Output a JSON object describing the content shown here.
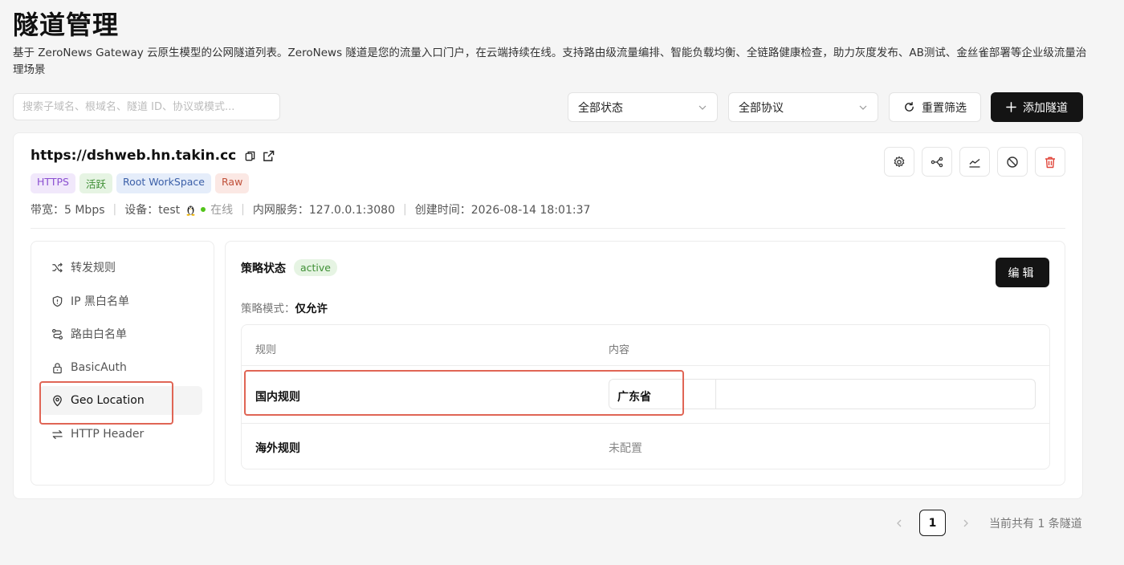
{
  "page": {
    "title": "隧道管理",
    "description": "基于 ZeroNews Gateway 云原生模型的公网隧道列表。ZeroNews 隧道是您的流量入口门户，在云端持续在线。支持路由级流量编排、智能负载均衡、全链路健康检查，助力灰度发布、AB测试、金丝雀部署等企业级流量治理场景"
  },
  "filters": {
    "search_placeholder": "搜索子域名、根域名、隧道 ID、协议或模式...",
    "search_value": "",
    "status_value": "全部状态",
    "protocol_value": "全部协议",
    "reset_label": "重置筛选",
    "add_label": "添加隧道"
  },
  "tunnel": {
    "url": "https://dshweb.hn.takin.cc",
    "tags": {
      "protocol": "HTTPS",
      "status": "活跃",
      "workspace": "Root WorkSpace",
      "mode": "Raw"
    },
    "meta": {
      "bandwidth": "带宽：5 Mbps",
      "device_prefix": "设备：test",
      "device_status": "在线",
      "service": "内网服务：127.0.0.1:3080",
      "created": "创建时间：2026-08-14 18:01:37"
    }
  },
  "side_nav": {
    "items": [
      {
        "label": "转发规则",
        "icon": "shuffle-icon"
      },
      {
        "label": "IP 黑白名单",
        "icon": "shield-icon"
      },
      {
        "label": "路由白名单",
        "icon": "route-icon"
      },
      {
        "label": "BasicAuth",
        "icon": "lock-icon"
      },
      {
        "label": "Geo Location",
        "icon": "map-pin-icon",
        "active": true
      },
      {
        "label": "HTTP Header",
        "icon": "swap-icon"
      }
    ]
  },
  "policy": {
    "status_label": "策略状态",
    "status_value": "active",
    "edit_label": "编辑",
    "mode_label": "策略模式：",
    "mode_value": "仅允许",
    "table": {
      "headers": [
        "规则",
        "内容"
      ],
      "rows": [
        {
          "rule": "国内规则",
          "content": "广东省"
        },
        {
          "rule": "海外规则",
          "content": "未配置"
        }
      ]
    }
  },
  "pagination": {
    "current": "1",
    "total_text": "当前共有 1 条隧道"
  },
  "colors": {
    "primary_button": "#141414",
    "highlight_border": "#e06555",
    "online_dot": "#52c41a"
  }
}
